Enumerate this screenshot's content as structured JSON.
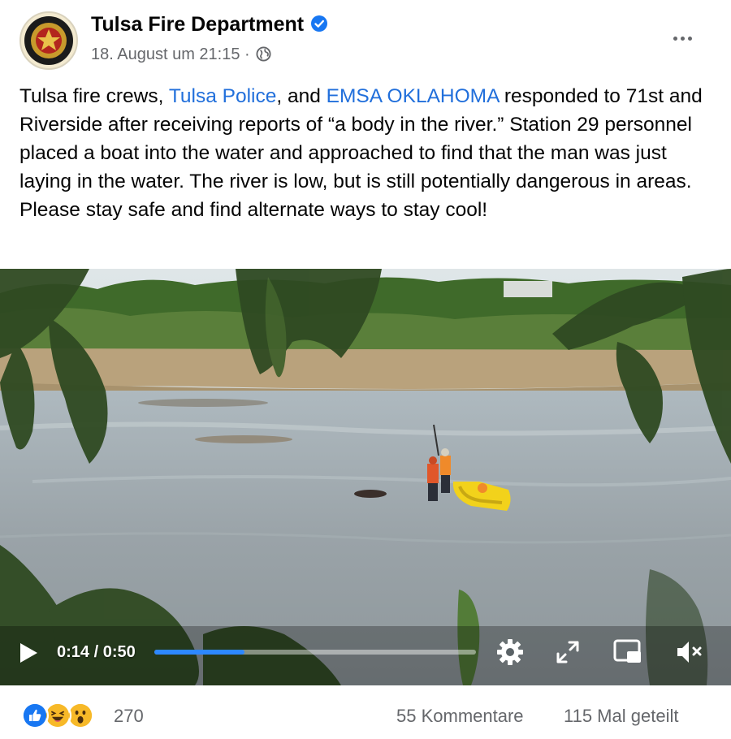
{
  "post": {
    "page_name": "Tulsa Fire Department",
    "timestamp": "18. August um 21:15",
    "separator": "·",
    "privacy_icon": "globe-icon",
    "verified_icon": "verified-badge-icon",
    "more_icon": "more-options-icon",
    "text": {
      "part1": "Tulsa fire crews, ",
      "mention1": "Tulsa Police",
      "part2": ", and ",
      "mention2": "EMSA OKLAHOMA",
      "part3": " responded to 71st and Riverside after receiving reports of “a body in the river.” Station 29 personnel placed a boat into the water and approached to find that the man was just laying in the water. The river is low, but is still potentially dangerous in areas. Please stay safe and find alternate ways to stay cool!"
    }
  },
  "video": {
    "current_time": "0:14",
    "duration": "0:50",
    "time_separator": " / ",
    "progress_fraction": 0.28,
    "controls": [
      "play-icon",
      "settings-gear-icon",
      "fullscreen-expand-icon",
      "picture-in-picture-icon",
      "volume-muted-icon"
    ]
  },
  "footer": {
    "reaction_icons": [
      "like-reaction-icon",
      "haha-reaction-icon",
      "wow-reaction-icon"
    ],
    "reaction_count": "270",
    "comments": "55 Kommentare",
    "shares": "115 Mal geteilt"
  },
  "colors": {
    "link": "#216fdb",
    "muted": "#65676b",
    "progress": "#2d88ff",
    "verified": "#1877f2"
  }
}
